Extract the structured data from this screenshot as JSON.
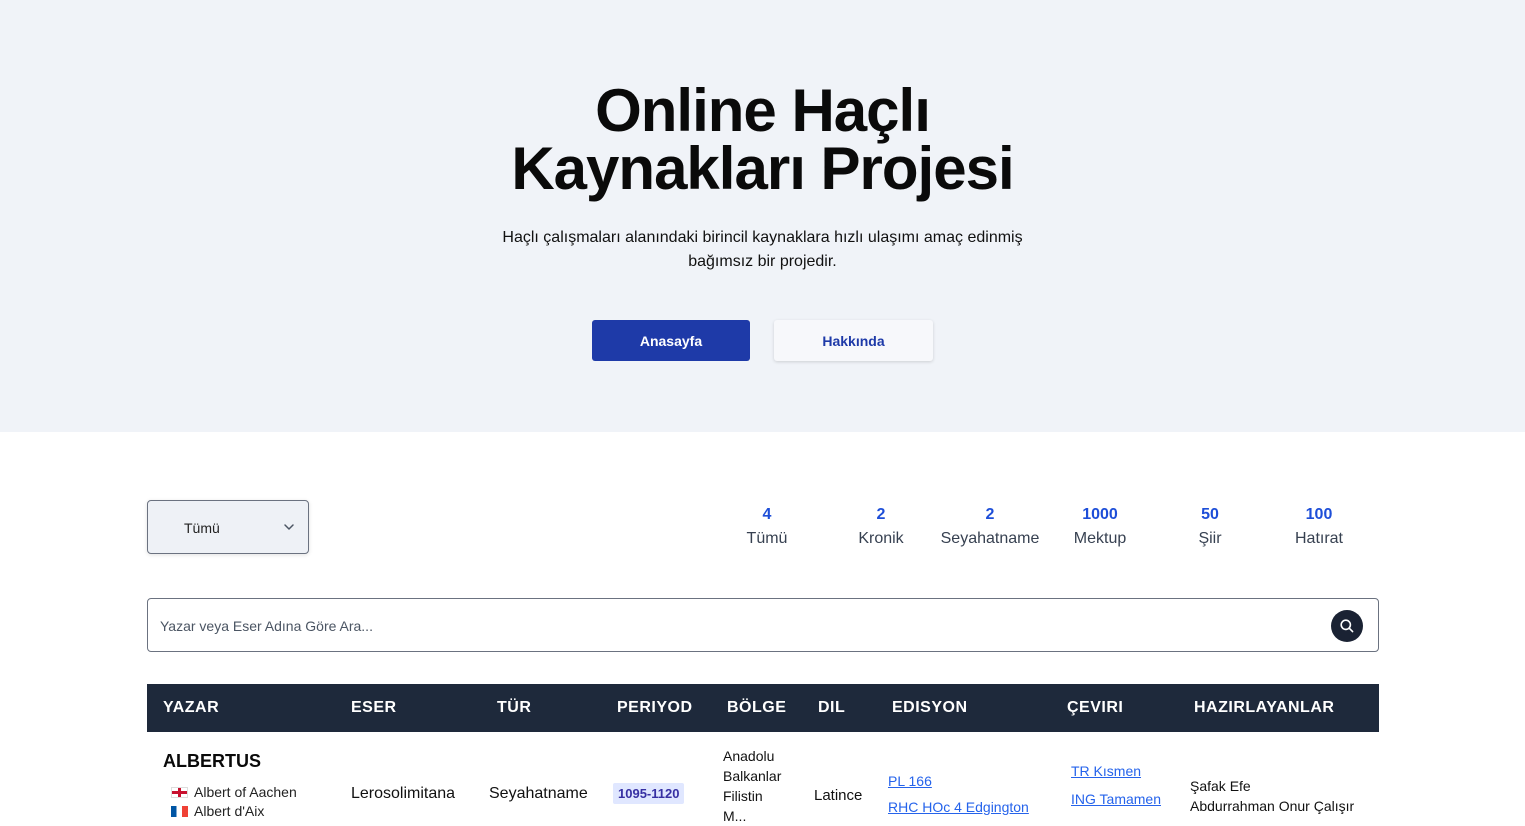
{
  "hero": {
    "title_line1": "Online Haçlı",
    "title_line2": "Kaynakları Projesi",
    "subtitle": "Haçlı çalışmaları alanındaki birincil kaynaklara hızlı ulaşımı amaç edinmiş bağımsız bir projedir.",
    "primary_button": "Anasayfa",
    "secondary_button": "Hakkında"
  },
  "filter": {
    "selected": "Tümü",
    "icon": "chevron-down-icon"
  },
  "stats": [
    {
      "count": "4",
      "label": "Tümü"
    },
    {
      "count": "2",
      "label": "Kronik"
    },
    {
      "count": "2",
      "label": "Seyahatname"
    },
    {
      "count": "1000",
      "label": "Mektup"
    },
    {
      "count": "50",
      "label": "Şiir"
    },
    {
      "count": "100",
      "label": "Hatırat"
    }
  ],
  "search": {
    "placeholder": "Yazar veya Eser Adına Göre Ara...",
    "icon": "search-icon"
  },
  "table": {
    "headers": [
      "YAZAR",
      "ESER",
      "TÜR",
      "PERIYOD",
      "BÖLGE",
      "DIL",
      "EDISYON",
      "ÇEVIRI",
      "HAZIRLAYANLAR"
    ],
    "rows": [
      {
        "author": "ALBERTUS",
        "aliases": [
          "Albert of Aachen",
          "Albert d'Aix"
        ],
        "work": "Lerosolimitana",
        "type": "Seyahatname",
        "period": "1095-1120",
        "regions": [
          "Anadolu",
          "Balkanlar",
          "Filistin",
          "M..."
        ],
        "language": "Latince",
        "editions": [
          "PL 166",
          "RHC HOc 4 Edgington"
        ],
        "translations": [
          "TR Kısmen",
          "ING Tamamen"
        ],
        "preparers": [
          "Şafak Efe",
          "Abdurrahman Onur Çalışır"
        ]
      }
    ]
  },
  "colors": {
    "hero_bg": "#f0f3f8",
    "primary": "#1e3aa8",
    "table_header": "#1e293b",
    "stat_number": "#1d4ed8",
    "link": "#2563eb"
  }
}
